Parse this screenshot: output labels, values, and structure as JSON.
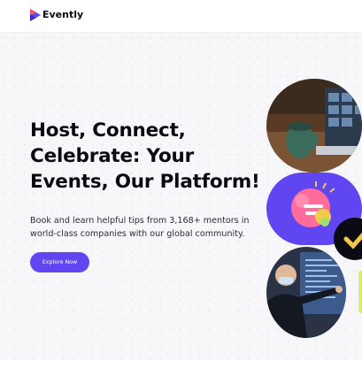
{
  "brand": {
    "name": "Evently",
    "logo_icon": "evently-logo-icon",
    "accent": "#6046f0"
  },
  "hero": {
    "headline": "Host, Connect, Celebrate: Your Events, Our Platform!",
    "subheadline": "Book and learn helpful tips from 3,168+ mentors in world-class companies with our global community.",
    "cta_label": "Explore Now"
  },
  "images": [
    {
      "name": "video-call-photo"
    },
    {
      "name": "brain-idea-illustration"
    },
    {
      "name": "presenter-photo"
    }
  ]
}
